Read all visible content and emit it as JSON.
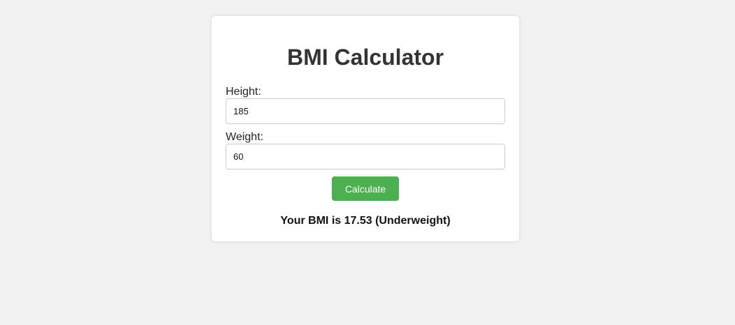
{
  "app": {
    "title": "BMI Calculator"
  },
  "form": {
    "height_label": "Height:",
    "height_value": "185",
    "weight_label": "Weight:",
    "weight_value": "60",
    "calculate_label": "Calculate"
  },
  "result": {
    "text": "Your BMI is 17.53 (Underweight)"
  },
  "colors": {
    "background": "#f2f2f2",
    "card": "#ffffff",
    "button": "#4caf50",
    "button_text": "#ffffff"
  }
}
